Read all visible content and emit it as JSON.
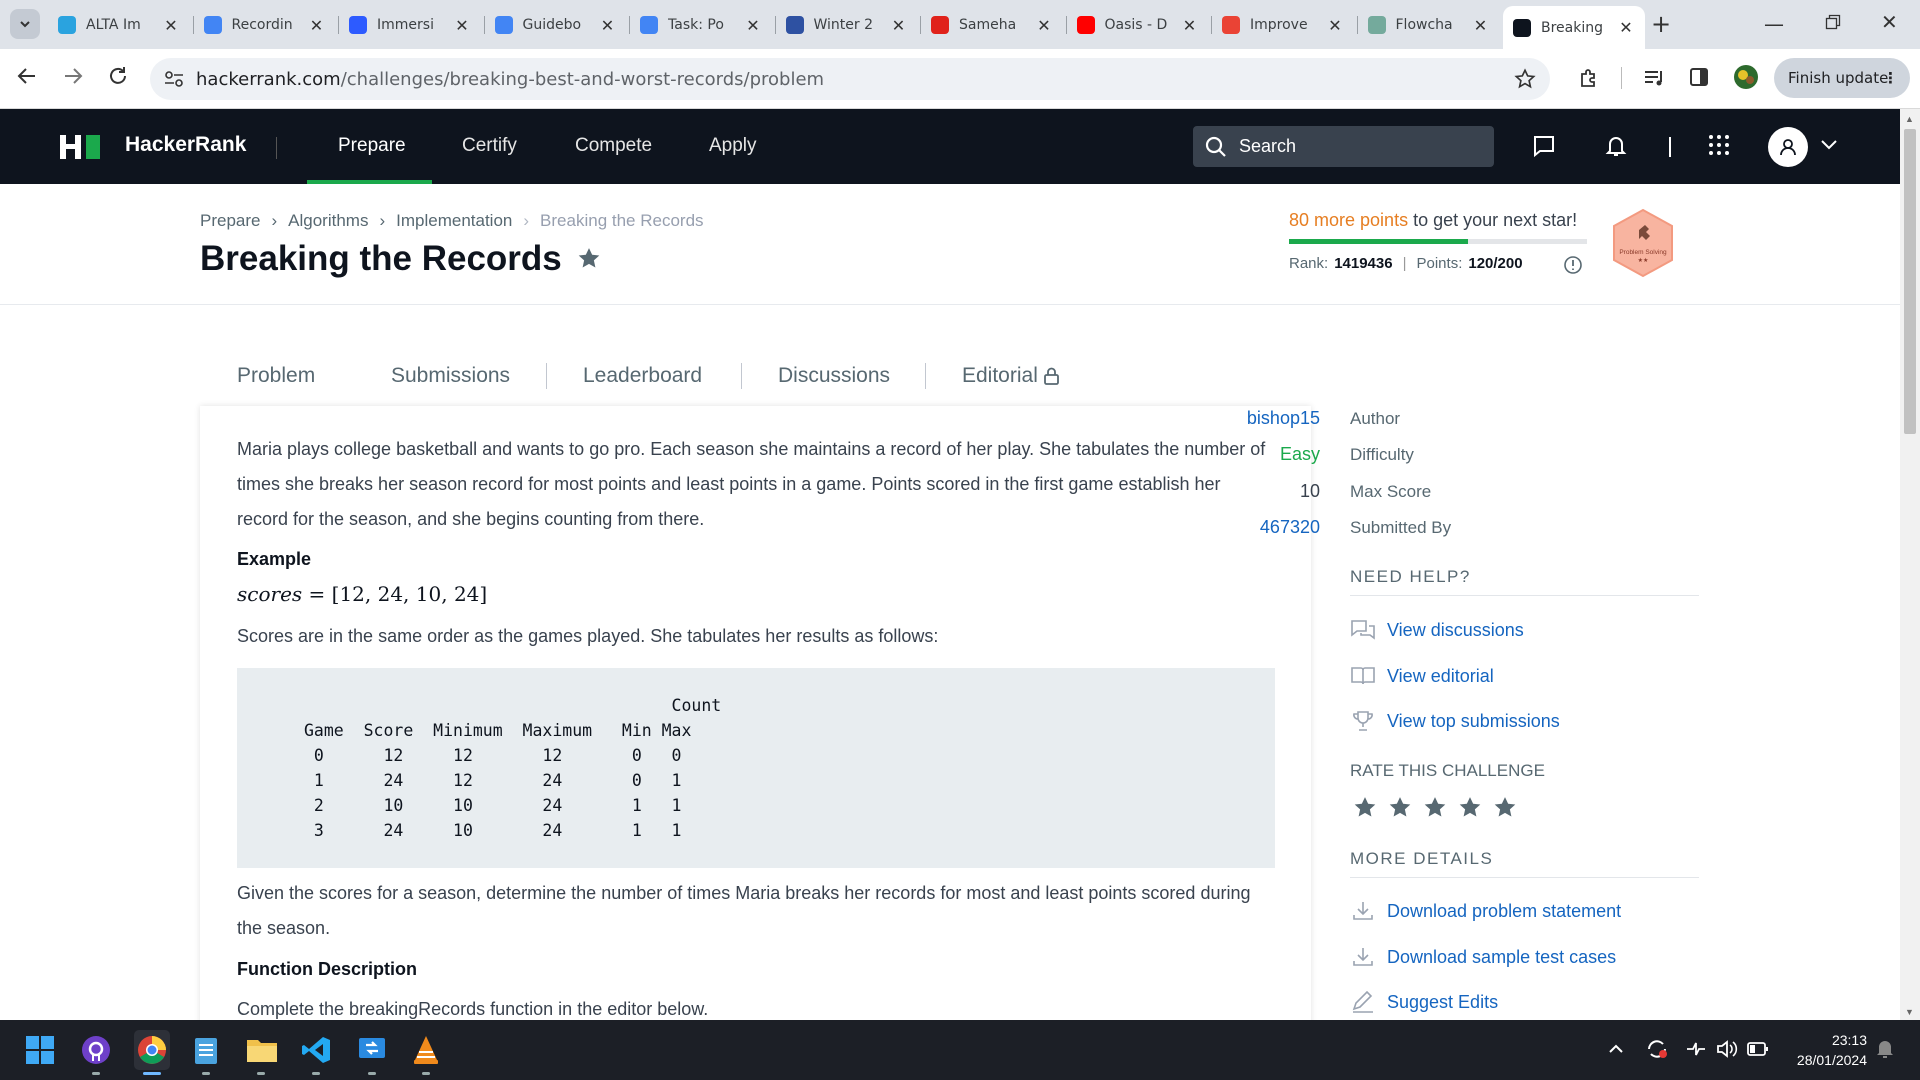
{
  "browser": {
    "tabs": [
      {
        "label": "ALTA Im",
        "icon": "telegram-icon",
        "color": "#2aa3df"
      },
      {
        "label": "Recordin",
        "icon": "google-docs-icon",
        "color": "#4285f4"
      },
      {
        "label": "Immersi",
        "icon": "zoom-icon",
        "color": "#2d5bff"
      },
      {
        "label": "Guidebo",
        "icon": "google-docs-icon",
        "color": "#4285f4"
      },
      {
        "label": "Task: Po",
        "icon": "google-docs-icon",
        "color": "#4285f4"
      },
      {
        "label": "Winter 2",
        "icon": "mal-icon",
        "color": "#2e51a2"
      },
      {
        "label": "Sameha",
        "icon": "scribd-icon",
        "color": "#e0221b"
      },
      {
        "label": "Oasis - D",
        "icon": "youtube-icon",
        "color": "#ff0000"
      },
      {
        "label": "Improve",
        "icon": "gmail-icon",
        "color": "#ea4335"
      },
      {
        "label": "Flowcha",
        "icon": "chatgpt-icon",
        "color": "#74aa9c"
      },
      {
        "label": "Breaking",
        "icon": "hackerrank-icon",
        "color": "#0e141e"
      }
    ],
    "url_host": "hackerrank.com",
    "url_path": "/challenges/breaking-best-and-worst-records/problem",
    "finish_update": "Finish update"
  },
  "nav": {
    "brand": "HackerRank",
    "items": [
      "Prepare",
      "Certify",
      "Compete",
      "Apply"
    ],
    "active": "Prepare",
    "search_placeholder": "Search"
  },
  "challenge": {
    "breadcrumbs": [
      "Prepare",
      "Algorithms",
      "Implementation",
      "Breaking the Records"
    ],
    "title": "Breaking the Records",
    "more_points": "80 more points",
    "next_star": " to get your next star!",
    "progress": 0.6,
    "rank_label": "Rank:",
    "rank": "1419436",
    "points_label": "Points:",
    "points": "120/200",
    "badge_label": "Problem Solving"
  },
  "tabs": [
    "Problem",
    "Submissions",
    "Leaderboard",
    "Discussions",
    "Editorial"
  ],
  "problem": {
    "intro": "Maria plays college basketball and wants to go pro. Each season she maintains a record of her play. She tabulates the number of times she breaks her season record for most points and least points in a game. Points scored in the first game establish her record for the season, and she begins counting from there.",
    "example_heading": "Example",
    "example_var": "scores",
    "example_value": " = [12, 24, 10, 24]",
    "order_text": "Scores are in the same order as the games played. She tabulates her results as follows:",
    "table": "                                     Count\nGame  Score  Minimum  Maximum   Min Max\n 0      12     12       12       0   0\n 1      24     12       24       0   1\n 2      10     10       24       1   1\n 3      24     10       24       1   1",
    "given_text": "Given the scores for a season, determine the number of times Maria breaks her records for most and least points scored during the season.",
    "function_heading": "Function Description",
    "function_text": "Complete the breakingRecords function in the editor below."
  },
  "sidebar": {
    "author_label": "Author",
    "author": "bishop15",
    "difficulty_label": "Difficulty",
    "difficulty": "Easy",
    "max_score_label": "Max Score",
    "max_score": "10",
    "submitted_label": "Submitted By",
    "submitted": "467320",
    "need_help": "NEED HELP?",
    "help_links": [
      "View discussions",
      "View editorial",
      "View top submissions"
    ],
    "rate_heading": "RATE THIS CHALLENGE",
    "more_details": "MORE DETAILS",
    "detail_links": [
      "Download problem statement",
      "Download sample test cases",
      "Suggest Edits"
    ]
  },
  "taskbar": {
    "time": "23:13",
    "date": "28/01/2024"
  },
  "colors": {
    "brand_green": "#1ba94c",
    "nav_bg": "#0e141e",
    "link_blue": "#1565c0",
    "easy_green": "#1ba94c",
    "points_orange": "#e67e22"
  }
}
